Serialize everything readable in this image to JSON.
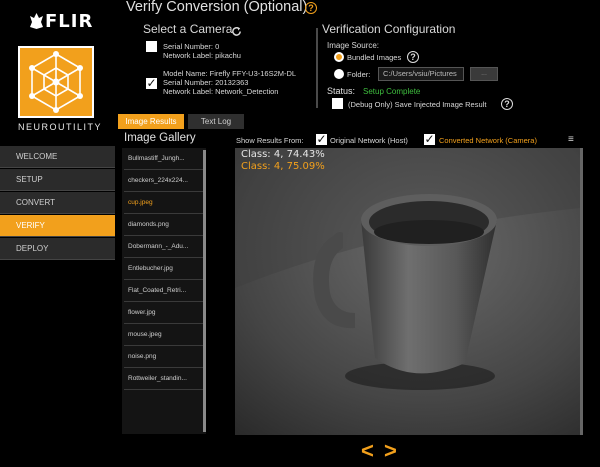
{
  "app": {
    "brand": "FLIR",
    "product": "NEUROUTILITY"
  },
  "sidebar": {
    "items": [
      {
        "label": "WELCOME",
        "active": false
      },
      {
        "label": "SETUP",
        "active": false
      },
      {
        "label": "CONVERT",
        "active": false
      },
      {
        "label": "VERIFY",
        "active": true
      },
      {
        "label": "DEPLOY",
        "active": false
      }
    ]
  },
  "header": {
    "title": "Verify Conversion (Optional)",
    "help": "?"
  },
  "camera": {
    "section_title": "Select a Camera",
    "cameras": [
      {
        "checked": false,
        "lines": [
          "Serial Number: 0",
          "Network Label: pikachu"
        ]
      },
      {
        "checked": true,
        "lines": [
          "Model Name:    Firefly FFY-U3-16S2M-DL",
          "Serial Number: 20132363",
          "Network Label: Network_Detection"
        ]
      }
    ]
  },
  "verification": {
    "section_title": "Verification Configuration",
    "image_source_label": "Image Source:",
    "bundled_label": "Bundled Images",
    "folder_label": "Folder:",
    "folder_value": "C:/Users/vsiu/Pictures",
    "browse_label": "...",
    "status_label": "Status:",
    "status_value": "Setup Complete",
    "debug_label": "(Debug Only) Save Injected Image Result"
  },
  "tabs": {
    "results": "Image Results",
    "log": "Text Log"
  },
  "gallery": {
    "title": "Image Gallery",
    "items": [
      "Bullmastiff_Jungh...",
      "checkers_224x224...",
      "cup.jpeg",
      "diamonds.png",
      "Dobermann_-_Adu...",
      "Entlebucher.jpg",
      "Flat_Coated_Retri...",
      "flower.jpg",
      "mouse.jpeg",
      "noise.png",
      "Rottweiler_standin..."
    ],
    "selected_index": 2
  },
  "results_bar": {
    "label": "Show Results From:",
    "original": "Original Network (Host)",
    "converted": "Converted Network (Camera)",
    "menu": "≡"
  },
  "overlay": {
    "host": "Class: 4, 74.43%",
    "camera": "Class: 4, 75.09%"
  },
  "pager": {
    "prev": "<",
    "next": ">"
  },
  "colors": {
    "accent": "#f2a01c",
    "status_ok": "#3fbf3f",
    "panel": "#2b2b2b"
  }
}
